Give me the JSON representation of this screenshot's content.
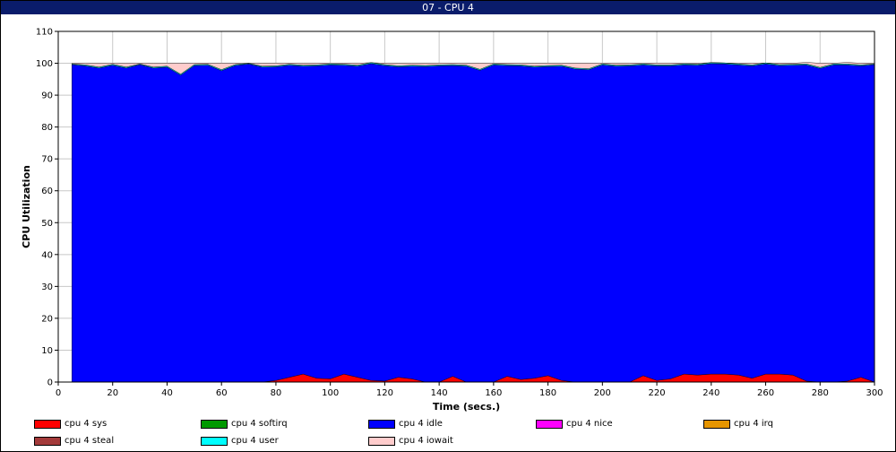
{
  "window": {
    "title": "07 - CPU 4"
  },
  "chart_data": {
    "type": "area",
    "title": "07 - CPU 4",
    "xlabel": "Time (secs.)",
    "ylabel": "CPU Utilization",
    "xlim": [
      0,
      300
    ],
    "ylim": [
      0,
      110
    ],
    "x_ticks": [
      0,
      20,
      40,
      60,
      80,
      100,
      120,
      140,
      160,
      180,
      200,
      220,
      240,
      260,
      280,
      300
    ],
    "y_ticks": [
      0,
      10,
      20,
      30,
      40,
      50,
      60,
      70,
      80,
      90,
      100,
      110
    ],
    "grid": true,
    "stacked": true,
    "legend_position": "bottom",
    "x": [
      5,
      10,
      15,
      20,
      25,
      30,
      35,
      40,
      45,
      50,
      55,
      60,
      65,
      70,
      75,
      80,
      85,
      90,
      95,
      100,
      105,
      110,
      115,
      120,
      125,
      130,
      135,
      140,
      145,
      150,
      155,
      160,
      165,
      170,
      175,
      180,
      185,
      190,
      195,
      200,
      205,
      210,
      215,
      220,
      225,
      230,
      235,
      240,
      245,
      250,
      255,
      260,
      265,
      270,
      275,
      280,
      285,
      290,
      295,
      300
    ],
    "series": [
      {
        "name": "cpu 4 sys",
        "color": "#ff0000",
        "values": [
          0,
          0,
          0,
          0,
          0,
          0,
          0,
          0,
          0,
          0,
          0,
          0,
          0,
          0,
          0,
          0.5,
          1.5,
          2.5,
          1.2,
          1,
          2.5,
          1.5,
          0.5,
          0.3,
          1.5,
          1,
          0,
          0,
          1.8,
          0,
          0,
          0,
          1.8,
          0.8,
          1.2,
          2,
          0.5,
          0,
          0,
          0,
          0,
          0,
          2,
          0.5,
          1,
          2.5,
          2.2,
          2.5,
          2.5,
          2.2,
          1.2,
          2.5,
          2.5,
          2.2,
          0.3,
          0,
          0,
          0.3,
          1.5,
          0
        ]
      },
      {
        "name": "cpu 4 softirq",
        "color": "#009900",
        "values": [
          0,
          0,
          0,
          0,
          0,
          0,
          0,
          0,
          0,
          0,
          0,
          0,
          0,
          0,
          0,
          0,
          0,
          0,
          0,
          0,
          0,
          0,
          0,
          0,
          0,
          0,
          0,
          0,
          0,
          0,
          0,
          0,
          0,
          0,
          0,
          0,
          0,
          0,
          0,
          0,
          0,
          0,
          0,
          0,
          0,
          0,
          0,
          0,
          0,
          0,
          0,
          0,
          0,
          0,
          0,
          0,
          0,
          0,
          0,
          0
        ]
      },
      {
        "name": "cpu 4 idle",
        "color": "#0000ff",
        "values": [
          99.6,
          99.2,
          98.5,
          99.4,
          98.5,
          99.6,
          98.5,
          98.8,
          96.3,
          99.3,
          99.4,
          97.7,
          99.3,
          99.8,
          98.8,
          98.4,
          97.9,
          96.6,
          98,
          98.5,
          96.9,
          97.6,
          99.4,
          99,
          97.4,
          98.1,
          99,
          99.2,
          97.5,
          99.1,
          97.8,
          99.5,
          97.5,
          98.4,
          97.6,
          97,
          98.6,
          98.2,
          98,
          99.5,
          99.1,
          99.2,
          97.5,
          98.7,
          98.2,
          97,
          97.2,
          97.4,
          97.3,
          97.3,
          98,
          97.3,
          96.8,
          97.2,
          99.2,
          98.4,
          99.5,
          99.2,
          97.7,
          99.6
        ]
      },
      {
        "name": "cpu 4 nice",
        "color": "#ff00ff",
        "values": [
          0,
          0,
          0,
          0,
          0,
          0,
          0,
          0,
          0,
          0,
          0,
          0,
          0,
          0,
          0,
          0,
          0,
          0,
          0,
          0,
          0,
          0,
          0,
          0,
          0,
          0,
          0,
          0,
          0,
          0,
          0,
          0,
          0,
          0,
          0,
          0,
          0,
          0,
          0,
          0,
          0,
          0,
          0,
          0,
          0,
          0,
          0,
          0,
          0,
          0,
          0,
          0,
          0,
          0,
          0,
          0,
          0,
          0,
          0,
          0
        ]
      },
      {
        "name": "cpu 4 irq",
        "color": "#e69500",
        "values": [
          0,
          0,
          0,
          0,
          0,
          0,
          0,
          0,
          0,
          0,
          0,
          0,
          0,
          0,
          0,
          0,
          0,
          0,
          0,
          0,
          0,
          0,
          0,
          0,
          0,
          0,
          0,
          0,
          0,
          0,
          0,
          0,
          0,
          0,
          0,
          0,
          0,
          0,
          0,
          0,
          0,
          0,
          0,
          0,
          0,
          0,
          0,
          0,
          0,
          0,
          0,
          0,
          0,
          0,
          0,
          0,
          0,
          0,
          0,
          0
        ]
      },
      {
        "name": "cpu 4 steal",
        "color": "#a33a3a",
        "values": [
          0,
          0,
          0,
          0,
          0,
          0,
          0,
          0,
          0,
          0,
          0,
          0,
          0,
          0,
          0,
          0,
          0,
          0,
          0,
          0,
          0,
          0,
          0,
          0,
          0,
          0,
          0,
          0,
          0,
          0,
          0,
          0,
          0,
          0,
          0,
          0,
          0,
          0,
          0,
          0,
          0,
          0,
          0,
          0,
          0,
          0,
          0,
          0,
          0,
          0,
          0,
          0,
          0,
          0,
          0,
          0,
          0,
          0,
          0,
          0
        ]
      },
      {
        "name": "cpu 4 user",
        "color": "#00ffff",
        "values": [
          0.2,
          0.3,
          0.3,
          0.3,
          0.3,
          0.2,
          0.3,
          0.3,
          0.3,
          0.3,
          0.3,
          0.3,
          0.3,
          0.2,
          0.3,
          0.3,
          0.3,
          0.3,
          0.3,
          0.3,
          0.3,
          0.3,
          0.3,
          0.3,
          0.3,
          0.3,
          0.3,
          0.3,
          0.3,
          0.3,
          0.3,
          0.3,
          0.3,
          0.3,
          0.3,
          0.3,
          0.3,
          0.3,
          0.3,
          0.3,
          0.3,
          0.3,
          0.3,
          0.3,
          0.3,
          0.3,
          0.3,
          0.3,
          0.3,
          0.3,
          0.3,
          0.3,
          0.3,
          0.3,
          0.3,
          0.3,
          0.3,
          0.3,
          0.3,
          0.2
        ]
      },
      {
        "name": "cpu 4 iowait",
        "color": "#ffcccc",
        "values": [
          0.2,
          0.5,
          1.2,
          0.3,
          1.2,
          0.2,
          1.2,
          0.9,
          3.4,
          0.4,
          0.3,
          2,
          0.4,
          0,
          0.9,
          0.8,
          0.3,
          0.6,
          0.5,
          0.2,
          0.3,
          0.6,
          0.0,
          0.4,
          0.8,
          0.6,
          0.7,
          0.5,
          0.4,
          0.6,
          1.9,
          0.2,
          0.4,
          0.5,
          0.9,
          0.7,
          0.6,
          1.5,
          1.7,
          0.2,
          0.6,
          0.5,
          0.2,
          0.5,
          0.5,
          0.2,
          0.3,
          0,
          0,
          0.2,
          0.5,
          0,
          0.4,
          0.3,
          0.5,
          1.3,
          0.2,
          0.5,
          0.5,
          0.2
        ]
      }
    ]
  }
}
